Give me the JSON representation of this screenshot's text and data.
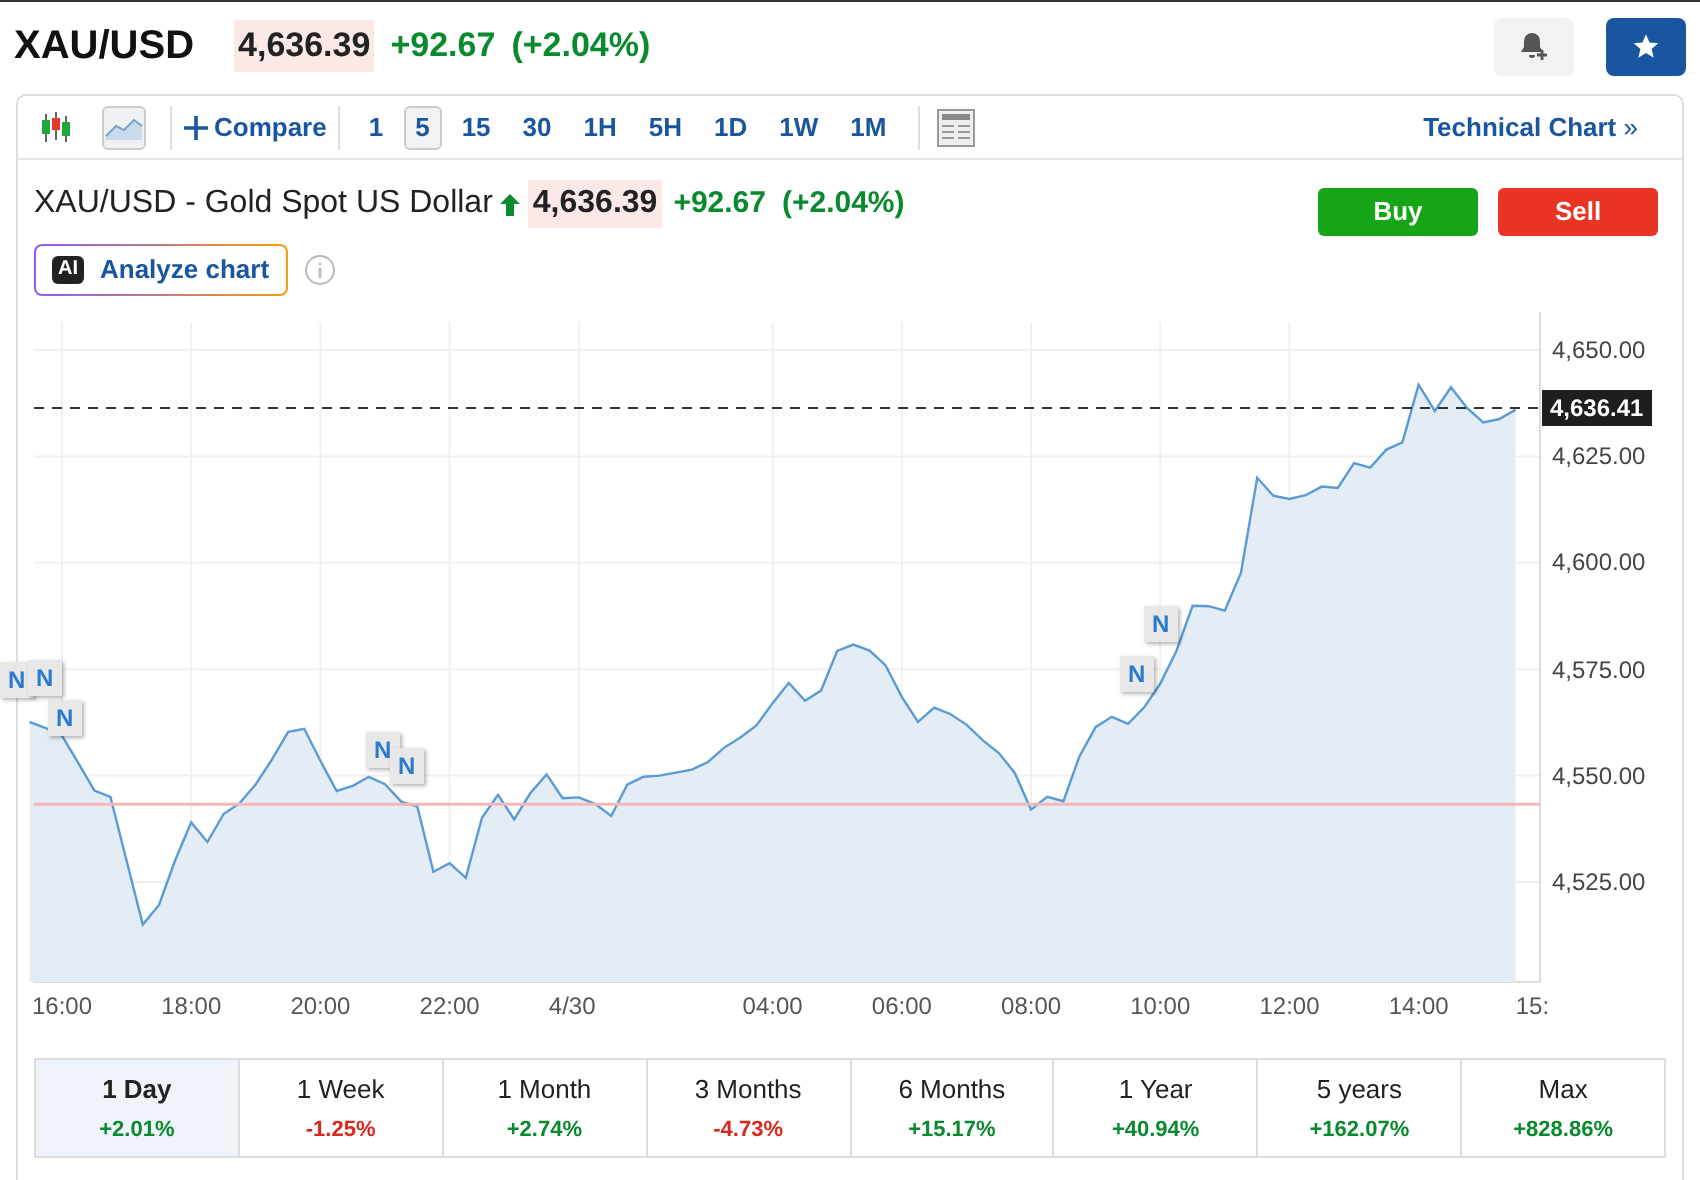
{
  "header": {
    "symbol": "XAU/USD",
    "price": "4,636.39",
    "change": "+92.67",
    "change_pct": "(+2.04%)"
  },
  "toolbar": {
    "chart_types": [
      {
        "kind": "candles",
        "selected": false
      },
      {
        "kind": "area",
        "selected": true
      }
    ],
    "compare": "Compare",
    "intervals": [
      {
        "label": "1",
        "selected": false
      },
      {
        "label": "5",
        "selected": true
      },
      {
        "label": "15",
        "selected": false
      },
      {
        "label": "30",
        "selected": false
      },
      {
        "label": "1H",
        "selected": false
      },
      {
        "label": "5H",
        "selected": false
      },
      {
        "label": "1D",
        "selected": false
      },
      {
        "label": "1W",
        "selected": false
      },
      {
        "label": "1M",
        "selected": false
      }
    ],
    "technical_chart": "Technical Chart",
    "technical_chart_arrow": "»"
  },
  "instrument": {
    "name": "XAU/USD - Gold Spot US Dollar",
    "rising": true,
    "price": "4,636.39",
    "change": "+92.67",
    "change_pct": "(+2.04%)"
  },
  "actions": {
    "buy": "Buy",
    "sell": "Sell",
    "analyze_badge": "AI",
    "analyze": "Analyze chart"
  },
  "chart_data": {
    "type": "area",
    "ylim": [
      4501.5,
      4656.6
    ],
    "categories": [
      null,
      null,
      "16:00",
      null,
      null,
      null,
      null,
      null,
      null,
      null,
      "18:00",
      null,
      null,
      null,
      null,
      null,
      null,
      null,
      "20:00",
      null,
      null,
      null,
      null,
      null,
      null,
      null,
      "22:00",
      null,
      null,
      null,
      null,
      null,
      null,
      null,
      "4/30",
      null,
      null,
      null,
      null,
      null,
      null,
      null,
      null,
      null,
      null,
      null,
      "04:00",
      null,
      null,
      null,
      null,
      null,
      null,
      null,
      "06:00",
      null,
      null,
      null,
      null,
      null,
      null,
      null,
      "08:00",
      null,
      null,
      null,
      null,
      null,
      null,
      null,
      "10:00",
      null,
      null,
      null,
      null,
      null,
      null,
      null,
      "12:00",
      null,
      null,
      null,
      null,
      null,
      null,
      null,
      "14:00",
      null,
      null,
      null,
      null,
      null,
      null,
      null
    ],
    "grid": true,
    "yticks": [
      {
        "value": 4525,
        "label": "4,525.00"
      },
      {
        "value": 4550,
        "label": "4,550.00"
      },
      {
        "value": 4575,
        "label": "4,575.00"
      },
      {
        "value": 4600,
        "label": "4,600.00"
      },
      {
        "value": 4625,
        "label": "4,625.00"
      },
      {
        "value": 4650,
        "label": "4,650.00"
      }
    ],
    "series": [
      {
        "color": "#5b9bd5",
        "values": [
          4562.6,
          4561.2,
          4559.4,
          4553,
          4546.5,
          4545,
          4530,
          4515,
          4519.6,
          4530,
          4539,
          4534.4,
          4541,
          4543.5,
          4548,
          4553.8,
          4560.3,
          4561,
          4553.5,
          4546.4,
          4547.6,
          4549.7,
          4548,
          4543.9,
          4542.7,
          4527.4,
          4529.4,
          4526,
          4540.1,
          4545.5,
          4539.7,
          4545.9,
          4550.3,
          4544.7,
          4544.9,
          4543.4,
          4540.5,
          4547.9,
          4549.7,
          4550,
          4550.7,
          4551.4,
          4553.2,
          4556.6,
          4559,
          4561.8,
          4567,
          4571.8,
          4567.6,
          4570,
          4579.3,
          4580.8,
          4579.4,
          4575.9,
          4568.5,
          4562.6,
          4566,
          4564.5,
          4562,
          4558.3,
          4555.3,
          4550.6,
          4542,
          4545,
          4544,
          4554.5,
          4561.4,
          4563.8,
          4562.2,
          4566,
          4571.6,
          4579.3,
          4589.9,
          4589.8,
          4588.8,
          4597.7,
          4620,
          4615.8,
          4615,
          4615.9,
          4617.9,
          4617.6,
          4623.4,
          4622.4,
          4626.6,
          4628.3,
          4641.9,
          4635.7,
          4641.3,
          4636.4,
          4633,
          4633.8,
          4636,
          null
        ]
      }
    ],
    "ref_lines": [
      {
        "axis": "y",
        "value": 4636.41,
        "label": "4,636.41"
      },
      {
        "axis": "y",
        "value": 4543.3
      }
    ],
    "annotations": [
      {
        "y": 4572,
        "text": "N"
      },
      {
        "y": 4572.5,
        "text": "N"
      },
      {
        "y": 4563,
        "text": "N"
      },
      {
        "y": 4555.5,
        "text": "N"
      },
      {
        "y": 4551.8,
        "text": "N"
      },
      {
        "y": 4573.4,
        "text": "N"
      },
      {
        "y": 4585,
        "text": "N"
      }
    ]
  },
  "chart_cut_axis_label": "15:",
  "periods": [
    {
      "label": "1 Day",
      "change": "+2.01%",
      "negative": false,
      "selected": true
    },
    {
      "label": "1 Week",
      "change": "-1.25%",
      "negative": true,
      "selected": false
    },
    {
      "label": "1 Month",
      "change": "+2.74%",
      "negative": false,
      "selected": false
    },
    {
      "label": "3 Months",
      "change": "-4.73%",
      "negative": true,
      "selected": false
    },
    {
      "label": "6 Months",
      "change": "+15.17%",
      "negative": false,
      "selected": false
    },
    {
      "label": "1 Year",
      "change": "+40.94%",
      "negative": false,
      "selected": false
    },
    {
      "label": "5 years",
      "change": "+162.07%",
      "negative": false,
      "selected": false
    },
    {
      "label": "Max",
      "change": "+828.86%",
      "negative": false,
      "selected": false
    }
  ]
}
